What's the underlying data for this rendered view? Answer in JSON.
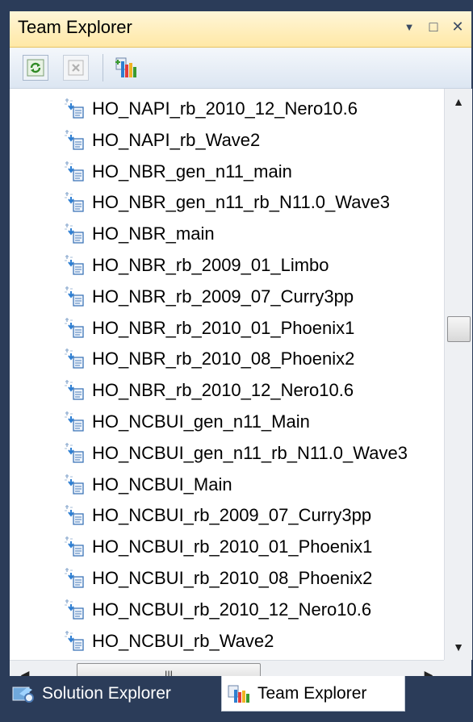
{
  "window": {
    "title": "Team Explorer",
    "buttons": {
      "dropdown": "▼",
      "maximize": "□",
      "close": "✕"
    }
  },
  "toolbar": {
    "items": [
      {
        "name": "refresh",
        "icon": "refresh-icon"
      },
      {
        "name": "stop",
        "icon": "stop-icon"
      },
      {
        "name": "connect",
        "icon": "connect-to-team-project-icon"
      }
    ]
  },
  "tree": {
    "items": [
      {
        "label": "HO_NAPI_rb_2010_12_Nero10.6"
      },
      {
        "label": "HO_NAPI_rb_Wave2"
      },
      {
        "label": "HO_NBR_gen_n11_main"
      },
      {
        "label": "HO_NBR_gen_n11_rb_N11.0_Wave3"
      },
      {
        "label": "HO_NBR_main"
      },
      {
        "label": "HO_NBR_rb_2009_01_Limbo"
      },
      {
        "label": "HO_NBR_rb_2009_07_Curry3pp"
      },
      {
        "label": "HO_NBR_rb_2010_01_Phoenix1"
      },
      {
        "label": "HO_NBR_rb_2010_08_Phoenix2"
      },
      {
        "label": "HO_NBR_rb_2010_12_Nero10.6"
      },
      {
        "label": "HO_NCBUI_gen_n11_Main"
      },
      {
        "label": "HO_NCBUI_gen_n11_rb_N11.0_Wave3"
      },
      {
        "label": "HO_NCBUI_Main"
      },
      {
        "label": "HO_NCBUI_rb_2009_07_Curry3pp"
      },
      {
        "label": "HO_NCBUI_rb_2010_01_Phoenix1"
      },
      {
        "label": "HO_NCBUI_rb_2010_08_Phoenix2"
      },
      {
        "label": "HO_NCBUI_rb_2010_12_Nero10.6"
      },
      {
        "label": "HO_NCBUI_rb_Wave2"
      }
    ]
  },
  "scrollbars": {
    "up": "▲",
    "down": "▼",
    "left": "◀",
    "right": "▶",
    "grip": "III",
    "vertical_position": 0.42
  },
  "tabs": [
    {
      "label": "Solution Explorer",
      "active": false,
      "icon": "solution-explorer-icon"
    },
    {
      "label": "Team Explorer",
      "active": true,
      "icon": "team-explorer-icon"
    }
  ],
  "colors": {
    "frame": "#2b3c59",
    "title_bar": "#ffe8a6",
    "accent_green": "#3b9b2f"
  }
}
